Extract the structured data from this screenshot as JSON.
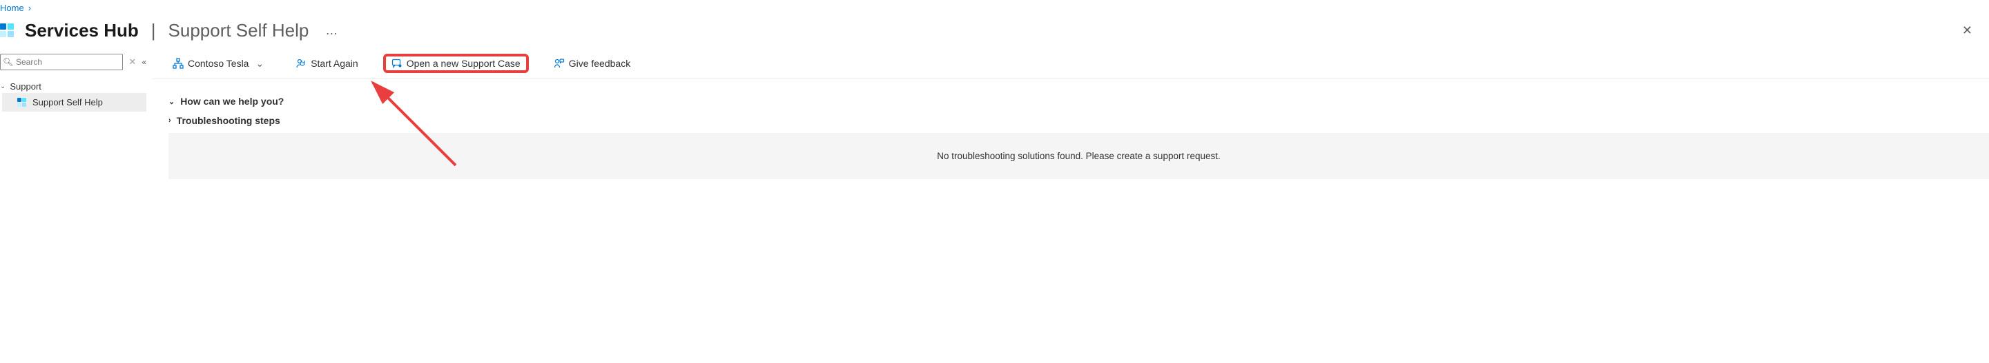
{
  "breadcrumb": {
    "home": "Home"
  },
  "header": {
    "title_main": "Services Hub",
    "separator": "|",
    "title_sub": "Support Self Help",
    "more": "…"
  },
  "sidebar": {
    "search_placeholder": "Search",
    "group_label": "Support",
    "items": [
      {
        "label": "Support Self Help",
        "selected": true
      }
    ]
  },
  "toolbar": {
    "workspace": "Contoso Tesla",
    "start_again": "Start Again",
    "open_case": "Open a new Support Case",
    "give_feedback": "Give feedback"
  },
  "sections": {
    "help_q": "How can we help you?",
    "troubleshoot": "Troubleshooting steps",
    "not_found_msg": "No troubleshooting solutions found. Please create a support request."
  },
  "annotation": {
    "highlight_target": "open_case",
    "arrow_color": "#e83e3e"
  }
}
